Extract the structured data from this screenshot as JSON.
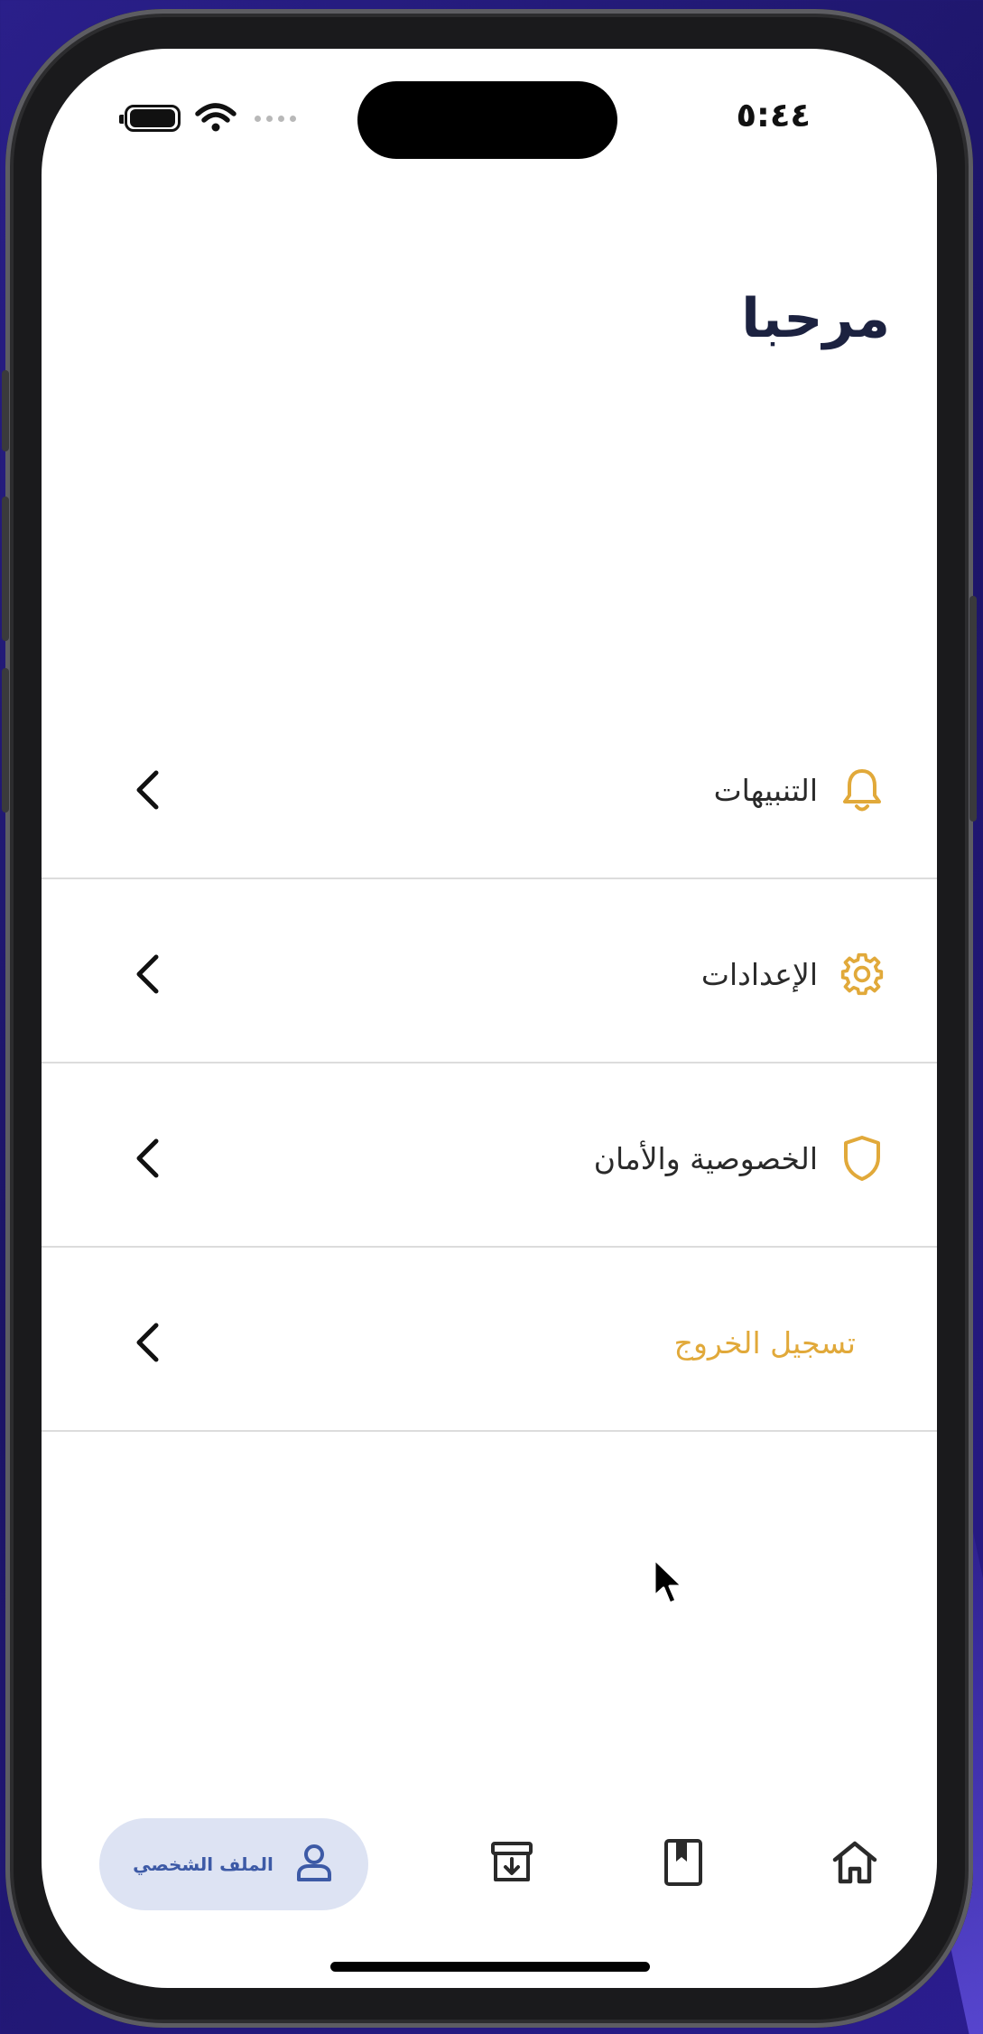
{
  "status_bar": {
    "time": "٥:٤٤"
  },
  "header": {
    "greeting": "مرحبا"
  },
  "menu": {
    "items": [
      {
        "label": "التنبيهات",
        "icon": "bell-icon"
      },
      {
        "label": "الإعدادات",
        "icon": "gear-icon"
      },
      {
        "label": "الخصوصية والأمان",
        "icon": "shield-icon"
      },
      {
        "label": "تسجيل الخروج",
        "icon": ""
      }
    ]
  },
  "tab_bar": {
    "profile_label": "الملف الشخصي",
    "tabs": [
      {
        "icon": "user-icon",
        "active": true
      },
      {
        "icon": "archive-download-icon",
        "active": false
      },
      {
        "icon": "bookmark-book-icon",
        "active": false
      },
      {
        "icon": "home-icon",
        "active": false
      }
    ]
  },
  "colors": {
    "accent": "#E1A93A",
    "heading": "#1C2240",
    "active_tab_bg": "#DDE3F3",
    "active_tab_fg": "#3D5AA6"
  }
}
